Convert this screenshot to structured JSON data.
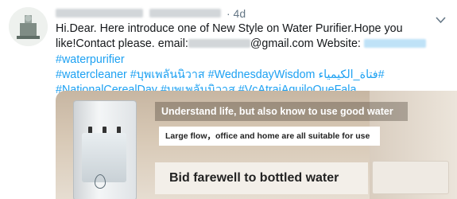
{
  "tweet": {
    "time": "· 4d",
    "text_parts": {
      "p1": "Hi.Dear. Here introduce one of New Style on Water Purifier.Hope you like!Contact please. email:",
      "p2": "@gmail.com Website:",
      "p3": " "
    },
    "hashtags": [
      "#waterpurifier",
      "#watercleaner",
      "#บุพเพลันนิวาส",
      "#WednesdayWisdom",
      "#فتاة_الكيمياء",
      "#NationalCerealDay",
      "#บุพเพลันนิวาส",
      "#VcAtraiAquiloQueFala"
    ]
  },
  "media": {
    "line1": "Understand life, but also know to use good water",
    "line2": "Large flow，office and home are all suitable for use",
    "line3": "Bid farewell to bottled water"
  },
  "colors": {
    "link": "#1da1f2",
    "text": "#14171a",
    "muted": "#657786"
  },
  "icons": {
    "caret": "chevron-down-icon",
    "avatar": "avatar"
  }
}
